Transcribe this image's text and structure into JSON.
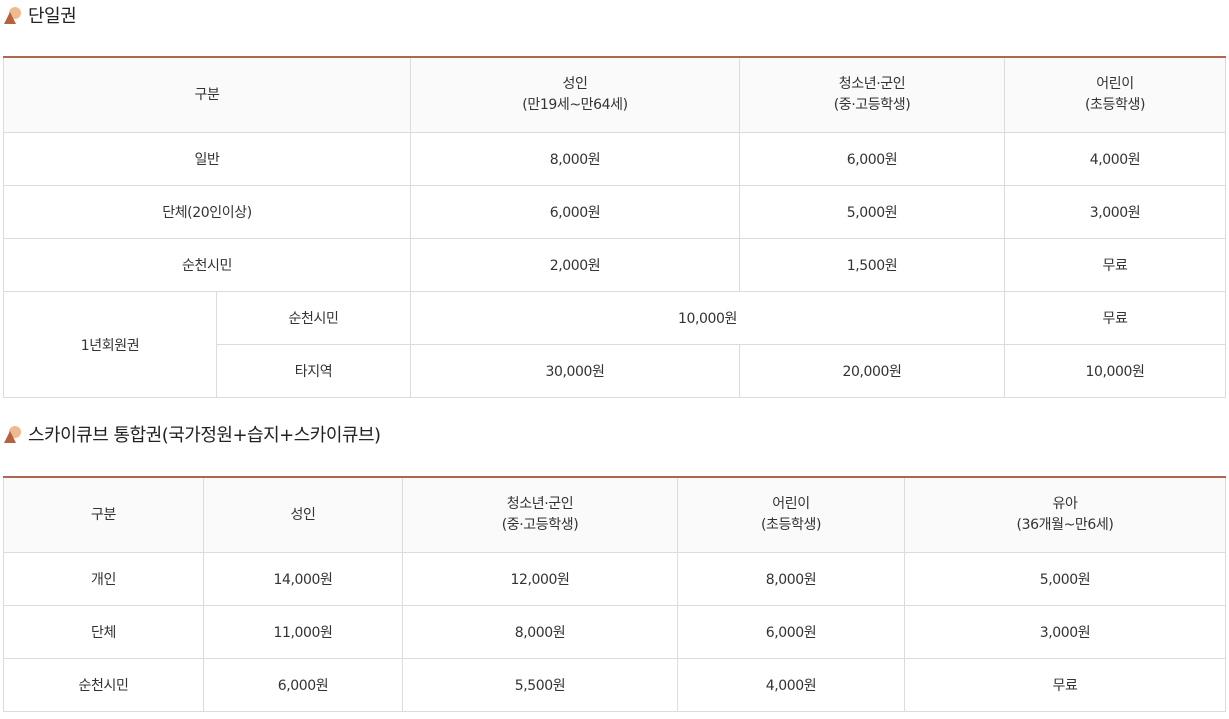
{
  "section1": {
    "title": "단일권",
    "headers": {
      "category": "구분",
      "adult": "성인",
      "adult_note": "(만19세~만64세)",
      "youth": "청소년·군인",
      "youth_note": "(중·고등학생)",
      "child": "어린이",
      "child_note": "(초등학생)"
    },
    "rows": [
      {
        "label": "일반",
        "adult": "8,000원",
        "youth": "6,000원",
        "child": "4,000원"
      },
      {
        "label": "단체(20인이상)",
        "adult": "6,000원",
        "youth": "5,000원",
        "child": "3,000원"
      },
      {
        "label": "순천시민",
        "adult": "2,000원",
        "youth": "1,500원",
        "child": "무료"
      }
    ],
    "annual": {
      "label": "1년회원권",
      "citizen": {
        "label": "순천시민",
        "adult_youth": "10,000원",
        "child": "무료"
      },
      "other": {
        "label": "타지역",
        "adult": "30,000원",
        "youth": "20,000원",
        "child": "10,000원"
      }
    }
  },
  "section2": {
    "title": "스카이큐브 통합권(국가정원+습지+스카이큐브)",
    "headers": {
      "category": "구분",
      "adult": "성인",
      "youth": "청소년·군인",
      "youth_note": "(중·고등학생)",
      "child": "어린이",
      "child_note": "(초등학생)",
      "infant": "유아",
      "infant_note": "(36개월~만6세)"
    },
    "rows": [
      {
        "label": "개인",
        "adult": "14,000원",
        "youth": "12,000원",
        "child": "8,000원",
        "infant": "5,000원"
      },
      {
        "label": "단체",
        "adult": "11,000원",
        "youth": "8,000원",
        "child": "6,000원",
        "infant": "3,000원"
      },
      {
        "label": "순천시민",
        "adult": "6,000원",
        "youth": "5,500원",
        "child": "4,000원",
        "infant": "무료"
      }
    ]
  },
  "colors": {
    "accent": "#b1664f",
    "bullet_light": "#f0b98f",
    "bullet_dark": "#b8623d",
    "header_bg": "#fafafa",
    "border": "#dcdcdc"
  },
  "icons": {
    "section_bullet": "mountain-sun-bullet-icon"
  }
}
